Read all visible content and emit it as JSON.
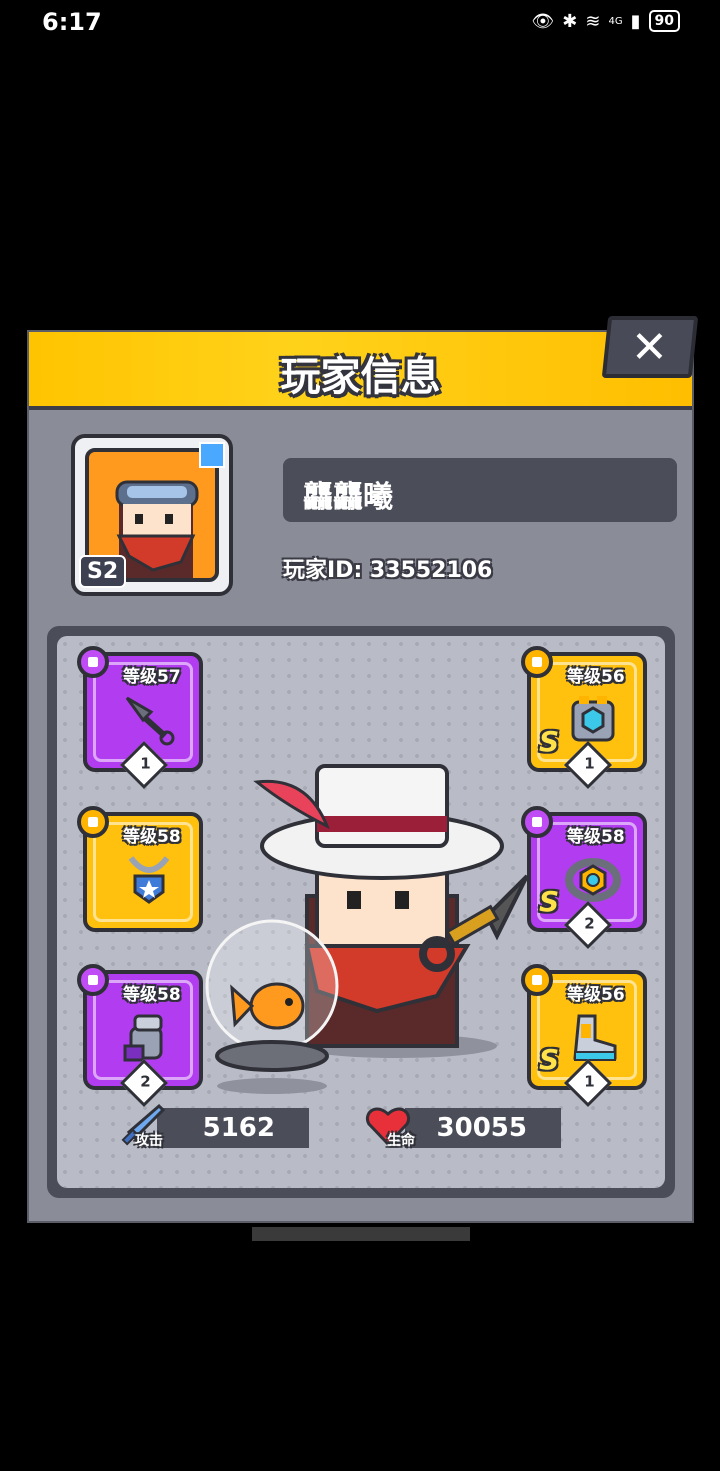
{
  "status_bar": {
    "time": "6:17",
    "network": "4G",
    "battery": "90"
  },
  "dialog": {
    "title": "玩家信息",
    "close_label": "✕",
    "player": {
      "name": "龘龘曦",
      "id_text": "玩家ID: 33552106",
      "season_tag": "S2"
    },
    "equipment": [
      {
        "slot": "weapon",
        "level": "等级57",
        "rank": "1",
        "rarity": "purple"
      },
      {
        "slot": "necklace",
        "level": "等级58",
        "rank": "",
        "rarity": "gold"
      },
      {
        "slot": "gloves",
        "level": "等级58",
        "rank": "2",
        "rarity": "purple"
      },
      {
        "slot": "armor",
        "level": "等级56",
        "rank": "1",
        "rarity": "gold",
        "grade": "S"
      },
      {
        "slot": "belt",
        "level": "等级58",
        "rank": "2",
        "rarity": "purple",
        "grade": "S"
      },
      {
        "slot": "boots",
        "level": "等级56",
        "rank": "1",
        "rarity": "gold",
        "grade": "S"
      }
    ],
    "stats": {
      "attack": {
        "label": "攻击",
        "value": "5162"
      },
      "health": {
        "label": "生命",
        "value": "30055"
      }
    }
  },
  "colors": {
    "banner": "#ffc400",
    "panel": "#8a8c98",
    "purple": "#b23cf0",
    "gold": "#ffc10d"
  }
}
